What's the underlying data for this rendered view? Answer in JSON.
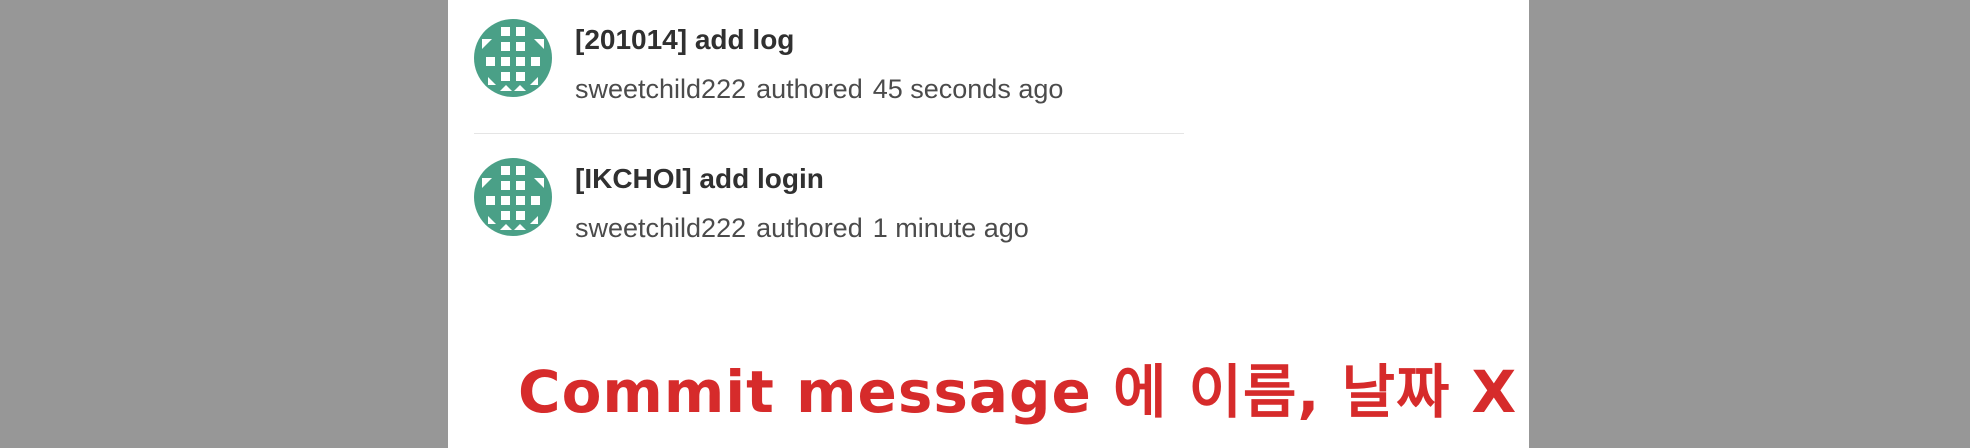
{
  "commits": [
    {
      "title": "[201014] add log",
      "author": "sweetchild222",
      "action": "authored",
      "time": "45 seconds ago",
      "avatar_color": "#4aa087"
    },
    {
      "title": "[IKCHOI] add login",
      "author": "sweetchild222",
      "action": "authored",
      "time": "1 minute ago",
      "avatar_color": "#4aa087"
    }
  ],
  "annotation": {
    "text": "Commit message 에 이름, 날짜 X",
    "color": "#d62b2b"
  },
  "colors": {
    "background": "#979797",
    "panel": "#ffffff"
  }
}
